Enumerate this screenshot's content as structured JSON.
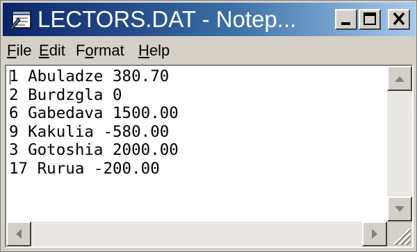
{
  "window": {
    "title": "LECTORS.DAT - Notep...",
    "icon": "notepad-icon",
    "controls": [
      "minimize-icon",
      "maximize-icon",
      "close-icon"
    ]
  },
  "menu": [
    {
      "accel": "F",
      "rest": "ile"
    },
    {
      "accel": "E",
      "rest": "dit"
    },
    {
      "pre": "F",
      "accel": "o",
      "rest": "rmat"
    },
    {
      "accel": "H",
      "rest": "elp"
    }
  ],
  "document": {
    "lines": [
      "1 Abuladze 380.70",
      "2 Burdzgla 0",
      "6 Gabedava 1500.00",
      "9 Kakulia -580.00",
      "3 Gotoshia 2000.00",
      "17 Rurua -200.00"
    ]
  },
  "colors": {
    "title_gradient_start": "#0a246a",
    "title_gradient_end": "#a6caf0",
    "chrome": "#d4d0c8"
  }
}
